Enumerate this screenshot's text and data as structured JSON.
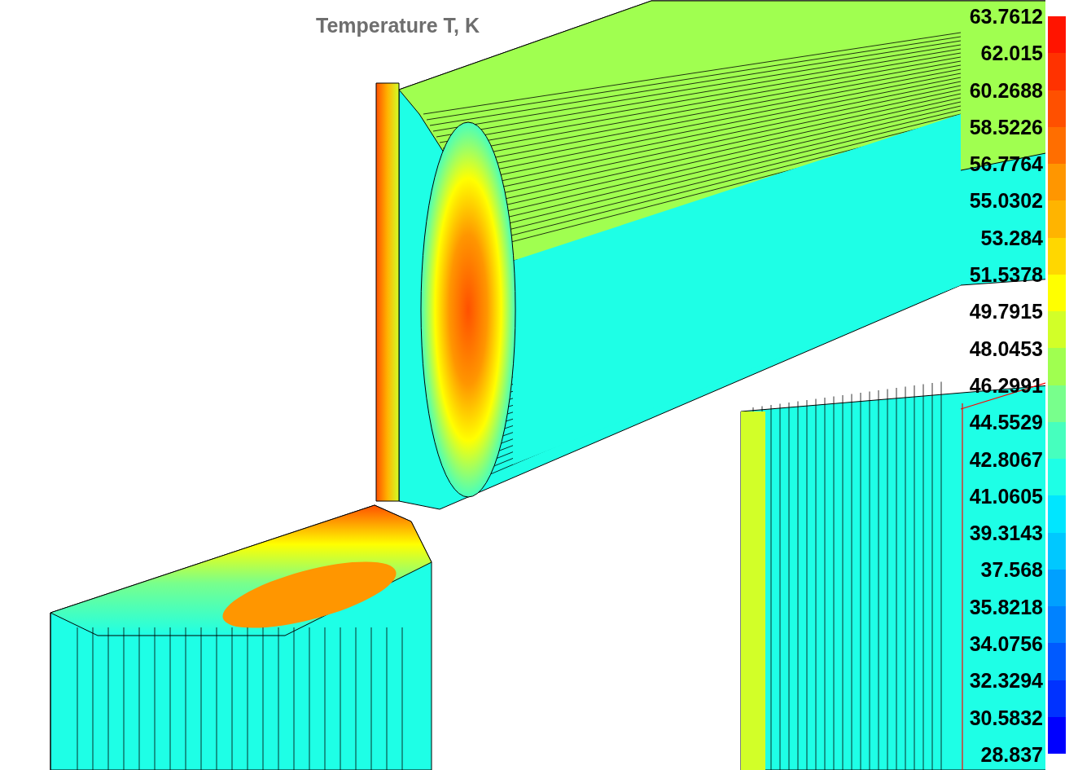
{
  "title": "Temperature T, K",
  "legend": {
    "labels": [
      "63.7612",
      "62.015",
      "60.2688",
      "58.5226",
      "56.7764",
      "55.0302",
      "53.284",
      "51.5378",
      "49.7915",
      "48.0453",
      "46.2991",
      "44.5529",
      "42.8067",
      "41.0605",
      "39.3143",
      "37.568",
      "35.8218",
      "34.0756",
      "32.3294",
      "30.5832",
      "28.837"
    ],
    "bands": [
      {
        "color": "#ff1400"
      },
      {
        "color": "#ff3200"
      },
      {
        "color": "#ff5000"
      },
      {
        "color": "#ff6e00"
      },
      {
        "color": "#ff9600"
      },
      {
        "color": "#ffb400"
      },
      {
        "color": "#ffd700"
      },
      {
        "color": "#ffff00"
      },
      {
        "color": "#d2ff28"
      },
      {
        "color": "#a0ff50"
      },
      {
        "color": "#78ff8c"
      },
      {
        "color": "#46ffbe"
      },
      {
        "color": "#1effe6"
      },
      {
        "color": "#00e6ff"
      },
      {
        "color": "#00c8ff"
      },
      {
        "color": "#00a0ff"
      },
      {
        "color": "#0082ff"
      },
      {
        "color": "#005aff"
      },
      {
        "color": "#0032ff"
      },
      {
        "color": "#0000ff"
      }
    ]
  }
}
